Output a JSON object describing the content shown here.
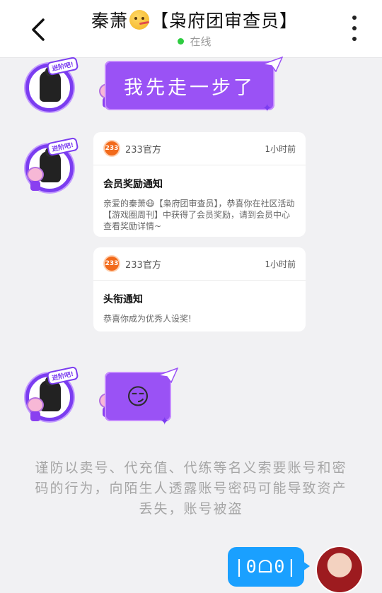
{
  "header": {
    "contact_name": "秦萧",
    "contact_title": "【枭府团审查员】",
    "status": "在线"
  },
  "messages": {
    "sticker_1_text": "我先走一步了",
    "avatar_tag": "进阶吧!",
    "card_1": {
      "sender": "233官方",
      "badge": "233",
      "time": "1小时前",
      "title": "会员奖励通知",
      "body": "亲爱的秦萧😷【枭府团审查员】，恭喜你在社区活动【游戏圈周刊】中获得了会员奖励，请到会员中心查看奖励详情~"
    },
    "card_2": {
      "sender": "233官方",
      "badge": "233",
      "time": "1小时前",
      "title": "头衔通知",
      "body": "恭喜你成为优秀人设奖!"
    },
    "sticker_2_emoji": "😏",
    "sent_text": "|0ᗝ0|"
  },
  "warning": "谨防以卖号、代充值、代练等名义索要账号和密码的行为，向陌生人透露账号密码可能导致资产丢失，账号被盗",
  "colors": {
    "accent_purple": "#9a52f5",
    "sent_blue": "#1aa0ff",
    "online_green": "#2ecc40",
    "official_orange": "#f26a1b"
  }
}
